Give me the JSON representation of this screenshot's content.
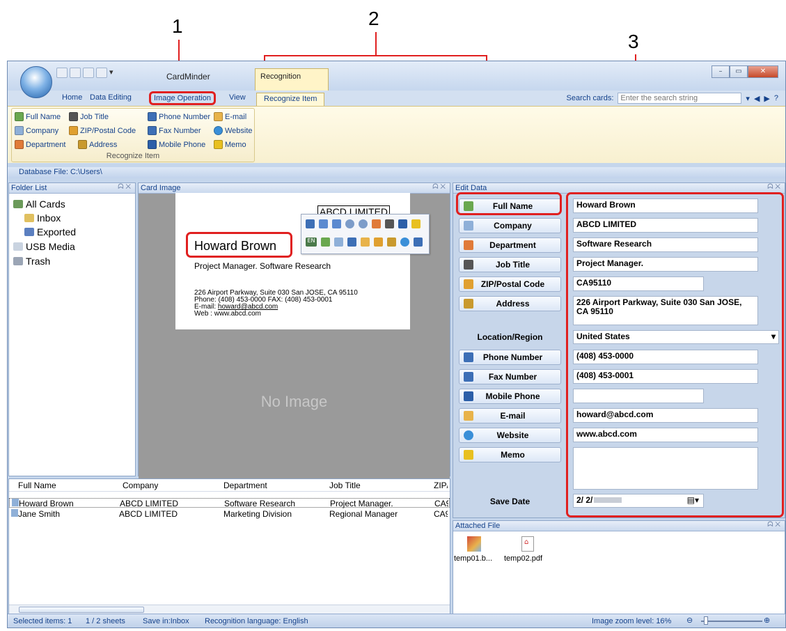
{
  "callouts": [
    "1",
    "2",
    "3"
  ],
  "app": {
    "title": "CardMinder",
    "context_tab": "Recognition"
  },
  "tabs": [
    "Home",
    "Data Editing",
    "Image Operation",
    "View",
    "Recognize Item"
  ],
  "search": {
    "label": "Search cards:",
    "placeholder": "Enter the search string"
  },
  "ribbon": {
    "group_label": "Recognize Item",
    "items": [
      "Full Name",
      "Job Title",
      "Phone Number",
      "E-mail",
      "Company",
      "ZIP/Postal Code",
      "Fax Number",
      "Website",
      "Department",
      "Address",
      "Mobile Phone",
      "Memo"
    ]
  },
  "db_file": "Database File: C:\\Users\\",
  "folders": {
    "title": "Folder List",
    "items": [
      "All Cards",
      "Inbox",
      "Exported",
      "USB Media",
      "Trash"
    ]
  },
  "card_image": {
    "title": "Card Image",
    "company": "ABCD LIMITED",
    "name": "Howard Brown",
    "position": "Project Manager. Software Research",
    "addr1": "226 Airport Parkway, Suite 030 San JOSE, CA 95110",
    "addr2": "Phone: (408) 453-0000     FAX: (408) 453-0001",
    "addr3_label": "E-mail: ",
    "addr3_email": "howard@abcd.com",
    "addr4": "Web    : www.abcd.com",
    "no_image": "No Image",
    "lang": "EN"
  },
  "list": {
    "headers": [
      "Full Name",
      "Company",
      "Department",
      "Job Title",
      "ZIP/"
    ],
    "rows": [
      [
        "Howard Brown",
        "ABCD LIMITED",
        "Software Research",
        "Project Manager.",
        "CA9"
      ],
      [
        "Jane Smith",
        "ABCD LIMITED",
        "Marketing Division",
        "Regional Manager",
        "CA9"
      ]
    ]
  },
  "edit": {
    "title": "Edit Data",
    "fields": [
      {
        "label": "Full Name",
        "value": "Howard Brown",
        "color": "#6aa84f"
      },
      {
        "label": "Company",
        "value": "ABCD LIMITED",
        "color": "#8fb0d8"
      },
      {
        "label": "Department",
        "value": "Software Research",
        "color": "#e07b39"
      },
      {
        "label": "Job Title",
        "value": "Project Manager.",
        "color": "#555555"
      },
      {
        "label": "ZIP/Postal Code",
        "value": "CA95110",
        "color": "#e0a030"
      },
      {
        "label": "Address",
        "value": "226 Airport Parkway, Suite 030 San JOSE,\nCA 95110",
        "color": "#c99a2e"
      },
      {
        "label": "Location/Region",
        "value": "United States"
      },
      {
        "label": "Phone Number",
        "value": "(408) 453-0000",
        "color": "#3d6fb6"
      },
      {
        "label": "Fax Number",
        "value": "(408) 453-0001",
        "color": "#3d6fb6"
      },
      {
        "label": "Mobile Phone",
        "value": "",
        "color": "#2c5fa8"
      },
      {
        "label": "E-mail",
        "value": "howard@abcd.com",
        "color": "#e8b34a"
      },
      {
        "label": "Website",
        "value": "www.abcd.com",
        "color": "#3a8fd8"
      },
      {
        "label": "Memo",
        "value": "",
        "color": "#e8c020"
      }
    ],
    "save_date_label": "Save Date",
    "save_date_value": "2/  2/"
  },
  "attached": {
    "title": "Attached File",
    "files": [
      "temp01.b...",
      "temp02.pdf"
    ]
  },
  "status": {
    "selected": "Selected items:   1",
    "sheets": "1 / 2 sheets",
    "save_in": "Save in:Inbox",
    "language": "Recognition language: English",
    "zoom": "Image zoom level:  16%"
  },
  "colors": {
    "highlight": "#e02020",
    "window_bg": "#c5d6ec",
    "ribbon_text": "#15428b"
  }
}
